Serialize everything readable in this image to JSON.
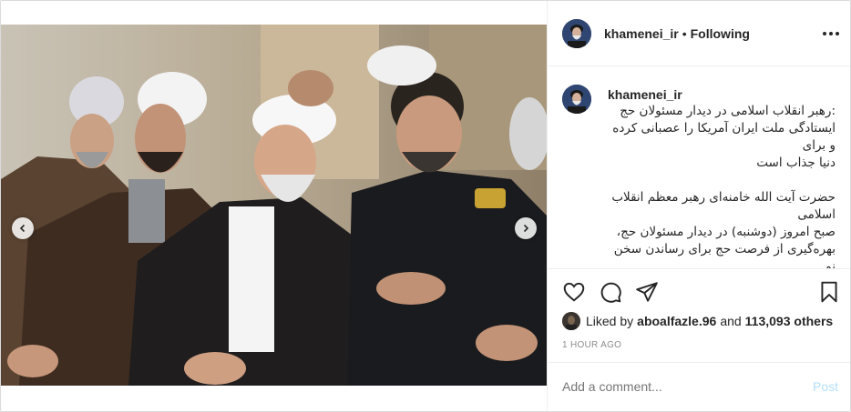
{
  "post": {
    "author": "khamenei_ir",
    "separator": "•",
    "follow_status": "Following",
    "more_options_icon": "ellipsis-icon",
    "media": {
      "carousel_total": 9,
      "carousel_active_index": 4,
      "prev_icon": "chevron-left-icon",
      "next_icon": "chevron-right-icon"
    },
    "caption": {
      "user": "khamenei_ir",
      "text": ":رهبر انقلاب اسلامی در دیدار مسئولان حج\nایستادگی ملت ایران آمریکا را عصبانی کرده و برای\nدنیا جذاب است\n\nحضرت آیت الله خامنه‌ای رهبر معظم انقلاب اسلامی\nصبح امروز (دوشنبه) در دیدار مسئولان حج،\nبهره‌گیری از فرصت حج برای رساندن سخن نو\nجمهوری اسلامی به دنیا یعنی الگوی مردمسالاری\nدینی را مورد تأکید قرار دادند و گفتند: ایستادگی\nجمهوری اسلامی ایران مقابل آمریکا و زیر بار زور"
    },
    "actions": {
      "like_icon": "heart-icon",
      "comment_icon": "comment-icon",
      "share_icon": "paper-plane-icon",
      "save_icon": "bookmark-icon"
    },
    "likes": {
      "prefix": "Liked by",
      "user": "aboalfazle.96",
      "connector": "and",
      "others": "113,093 others"
    },
    "time": "1 HOUR AGO",
    "add_comment": {
      "placeholder": "Add a comment...",
      "post_label": "Post"
    },
    "colors": {
      "border": "#dbdbdb",
      "text": "#262626",
      "muted": "#8e8e8e",
      "post_disabled": "#b2dffc"
    }
  }
}
